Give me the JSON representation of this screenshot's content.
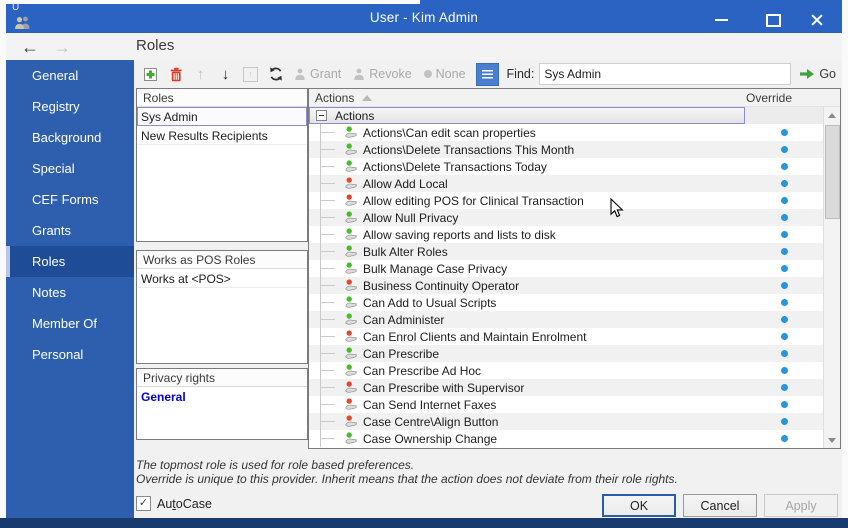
{
  "window": {
    "title": "User - Kim Admin",
    "corner_char": "U",
    "controls": {
      "minimize": "minimize",
      "maximize": "maximize",
      "close": "close"
    }
  },
  "nav": {
    "back": "←",
    "forward": "→",
    "page_title": "Roles"
  },
  "sidebar": {
    "selected_index": 6,
    "items": [
      {
        "label": "General"
      },
      {
        "label": "Registry"
      },
      {
        "label": "Background"
      },
      {
        "label": "Special"
      },
      {
        "label": "CEF Forms"
      },
      {
        "label": "Grants"
      },
      {
        "label": "Roles"
      },
      {
        "label": "Notes"
      },
      {
        "label": "Member Of"
      },
      {
        "label": "Personal"
      }
    ]
  },
  "toolbar": {
    "grant_label": "Grant",
    "revoke_label": "Revoke",
    "none_label": "None",
    "find_label": "Find:",
    "find_value": "Sys Admin",
    "go_label": "Go",
    "up_arrow": "↑",
    "down_arrow": "↓",
    "boxed_arrow": "↑"
  },
  "roles_panel": {
    "header": "Roles",
    "items": [
      {
        "label": "Sys Admin",
        "selected": true
      },
      {
        "label": "New Results Recipients",
        "selected": false
      }
    ]
  },
  "works_panel": {
    "header": "Works as POS Roles",
    "items": [
      {
        "label": "Works at <POS>"
      }
    ]
  },
  "privacy_panel": {
    "header": "Privacy rights",
    "items": [
      {
        "label": "General"
      }
    ]
  },
  "actions_panel": {
    "column_headers": {
      "actions": "Actions",
      "override": "Override"
    },
    "root_label": "Actions",
    "colors": {
      "granted": "#49bd26",
      "denied": "#e2492b",
      "override_dot": "#2795dd"
    },
    "rows": [
      {
        "label": "Actions\\Can edit scan properties",
        "status": "granted",
        "override": true
      },
      {
        "label": "Actions\\Delete Transactions This Month",
        "status": "granted",
        "override": true
      },
      {
        "label": "Actions\\Delete Transactions Today",
        "status": "granted",
        "override": true
      },
      {
        "label": "Allow Add Local",
        "status": "denied",
        "override": true
      },
      {
        "label": "Allow editing POS for Clinical Transaction",
        "status": "denied",
        "override": true
      },
      {
        "label": "Allow Null Privacy",
        "status": "granted",
        "override": true
      },
      {
        "label": "Allow saving reports and lists to disk",
        "status": "granted",
        "override": true
      },
      {
        "label": "Bulk Alter Roles",
        "status": "granted",
        "override": true
      },
      {
        "label": "Bulk Manage Case Privacy",
        "status": "granted",
        "override": true
      },
      {
        "label": "Business Continuity Operator",
        "status": "denied",
        "override": true
      },
      {
        "label": "Can Add to Usual Scripts",
        "status": "granted",
        "override": true
      },
      {
        "label": "Can Administer",
        "status": "granted",
        "override": true
      },
      {
        "label": "Can Enrol Clients and Maintain Enrolment",
        "status": "denied",
        "override": true
      },
      {
        "label": "Can Prescribe",
        "status": "granted",
        "override": true
      },
      {
        "label": "Can Prescribe Ad Hoc",
        "status": "granted",
        "override": true
      },
      {
        "label": "Can Prescribe with Supervisor",
        "status": "denied",
        "override": true
      },
      {
        "label": "Can Send Internet Faxes",
        "status": "denied",
        "override": true
      },
      {
        "label": "Case Centre\\Align Button",
        "status": "denied",
        "override": true
      },
      {
        "label": "Case Ownership Change",
        "status": "granted",
        "override": true
      }
    ]
  },
  "footer": {
    "note_line1": "The topmost role is used for role based preferences.",
    "note_line2": "Override is unique to this provider.  Inherit means that the action does not deviate from their role rights.",
    "checkbox": {
      "checked": true,
      "check_glyph": "✓",
      "label_pre": "Au",
      "label_accel": "t",
      "label_post": "oCase"
    },
    "buttons": [
      {
        "label": "OK",
        "state": "default"
      },
      {
        "label": "Cancel",
        "state": "normal"
      },
      {
        "label": "Apply",
        "state": "disabled"
      }
    ]
  }
}
